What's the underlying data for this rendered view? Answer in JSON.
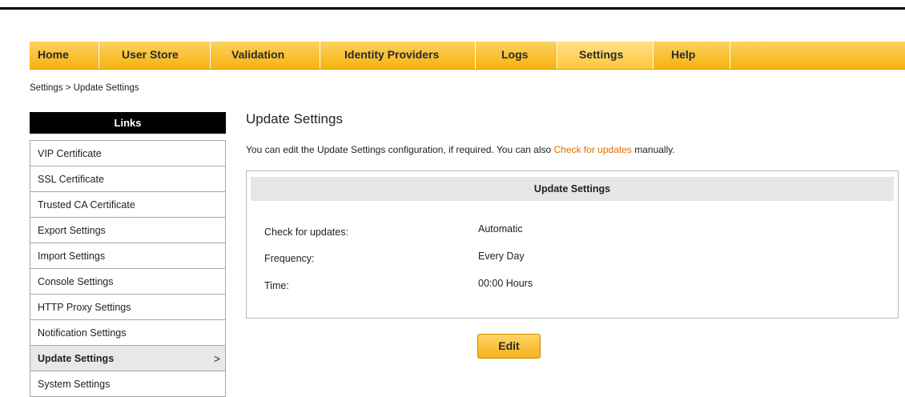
{
  "nav": {
    "items": [
      {
        "label": "Home"
      },
      {
        "label": "User Store"
      },
      {
        "label": "Validation"
      },
      {
        "label": "Identity Providers"
      },
      {
        "label": "Logs"
      },
      {
        "label": "Settings"
      },
      {
        "label": "Help"
      }
    ],
    "active": "Settings"
  },
  "breadcrumb": "Settings > Update Settings",
  "sidebar": {
    "header": "Links",
    "items": [
      {
        "label": "VIP Certificate"
      },
      {
        "label": "SSL Certificate"
      },
      {
        "label": "Trusted CA Certificate"
      },
      {
        "label": "Export Settings"
      },
      {
        "label": "Import Settings"
      },
      {
        "label": "Console Settings"
      },
      {
        "label": "HTTP Proxy Settings"
      },
      {
        "label": "Notification Settings"
      },
      {
        "label": "Update Settings"
      },
      {
        "label": "System Settings"
      }
    ],
    "active_chevron": ">"
  },
  "main": {
    "title": "Update Settings",
    "intro_prefix": "You can edit the Update Settings configuration, if required.  You can also ",
    "intro_link": "Check for updates",
    "intro_suffix": " manually.",
    "panel": {
      "header": "Update Settings",
      "rows": [
        {
          "label": "Check for updates:",
          "value": "Automatic"
        },
        {
          "label": "Frequency:",
          "value": "Every Day"
        },
        {
          "label": "Time:",
          "value": "00:00 Hours"
        }
      ]
    },
    "edit_label": "Edit"
  },
  "colors": {
    "nav_gradient_top": "#fdd25f",
    "nav_gradient_bottom": "#f6b20f",
    "link": "#e06c00",
    "sidebar_header_bg": "#000000"
  }
}
